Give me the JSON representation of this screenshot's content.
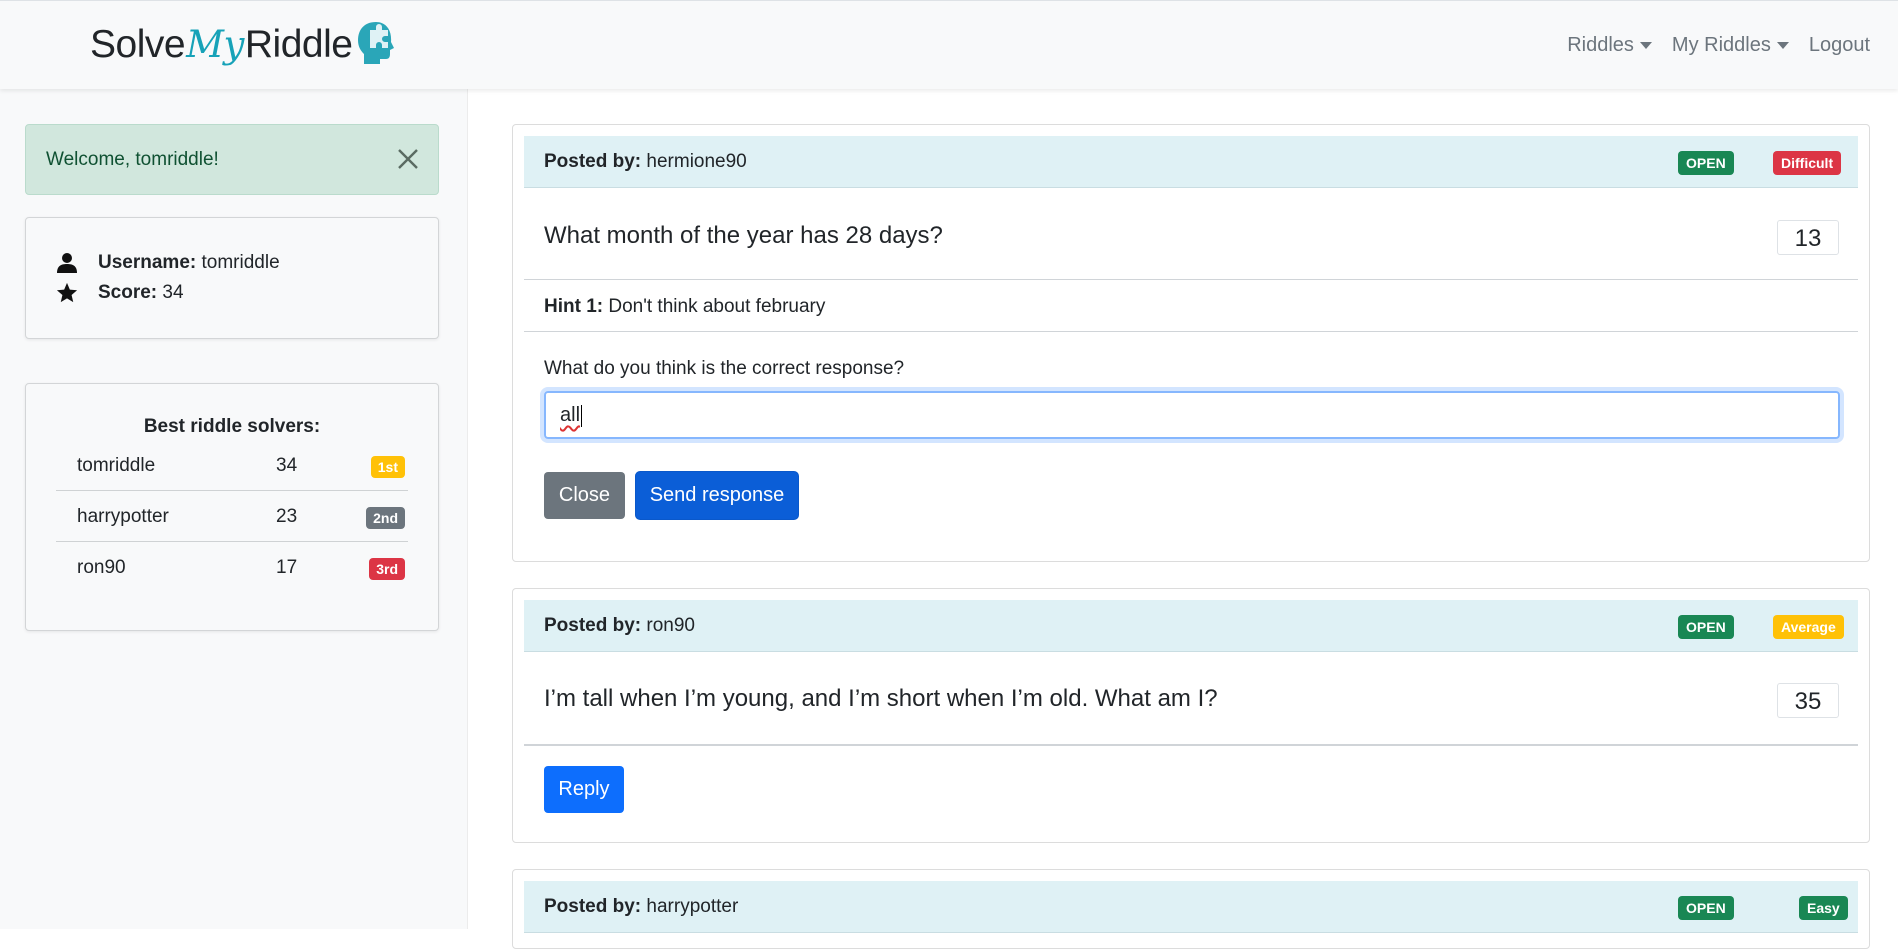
{
  "navbar": {
    "brand_solve": "Solve",
    "brand_my": "My",
    "brand_riddle": "Riddle",
    "items": [
      {
        "label": "Riddles",
        "dropdown": true
      },
      {
        "label": "My Riddles",
        "dropdown": true
      },
      {
        "label": "Logout",
        "dropdown": false
      }
    ]
  },
  "alert": {
    "text": "Welcome, tomriddle!"
  },
  "user": {
    "username_label": "Username:",
    "username": "tomriddle",
    "score_label": "Score:",
    "score": "34"
  },
  "leaderboard": {
    "title": "Best riddle solvers:",
    "rows": [
      {
        "name": "tomriddle",
        "score": "34",
        "rank": "1st",
        "color": "#ffc107"
      },
      {
        "name": "harrypotter",
        "score": "23",
        "rank": "2nd",
        "color": "#6c757d"
      },
      {
        "name": "ron90",
        "score": "17",
        "rank": "3rd",
        "color": "#dc3545"
      }
    ]
  },
  "riddles": [
    {
      "posted_by_label": "Posted by:",
      "author": "hermione90",
      "status": "OPEN",
      "difficulty": "Difficult",
      "difficulty_color": "#dc3545",
      "question": "What month of the year has 28 days?",
      "count": "13",
      "hint_label": "Hint 1:",
      "hint": "Don't think about february",
      "response_label": "What do you think is the correct response?",
      "response_value": "all",
      "close_label": "Close",
      "send_label": "Send response"
    },
    {
      "posted_by_label": "Posted by:",
      "author": "ron90",
      "status": "OPEN",
      "difficulty": "Average",
      "difficulty_color": "#ffc107",
      "question": "I’m tall when I’m young, and I’m short when I’m old. What am I?",
      "count": "35",
      "reply_label": "Reply"
    },
    {
      "posted_by_label": "Posted by:",
      "author": "harrypotter",
      "status": "OPEN",
      "difficulty": "Easy",
      "difficulty_color": "#198754"
    }
  ],
  "colors": {
    "open": "#198754",
    "primary": "#0d6efd",
    "secondary": "#6c757d"
  }
}
